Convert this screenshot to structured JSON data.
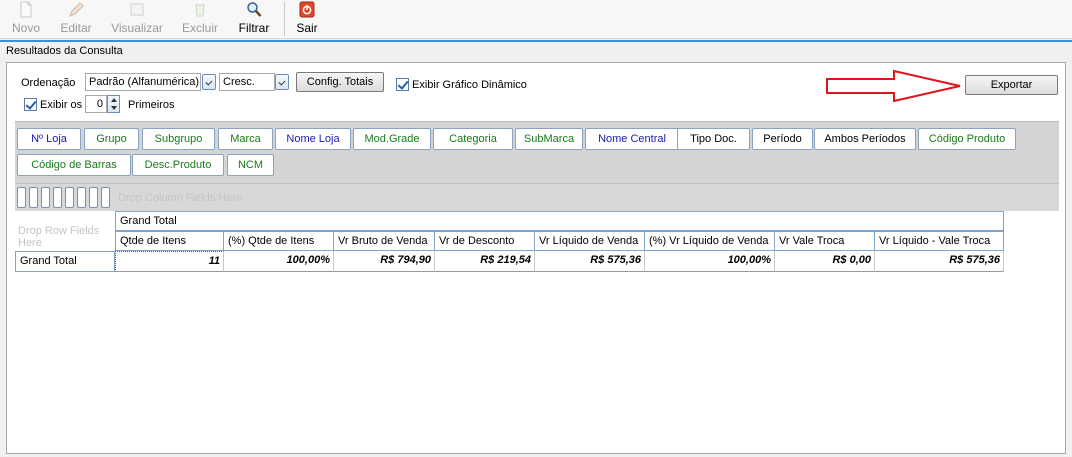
{
  "toolbar": {
    "novo": "Novo",
    "editar": "Editar",
    "visualizar": "Visualizar",
    "excluir": "Excluir",
    "filtrar": "Filtrar",
    "sair": "Sair"
  },
  "window": {
    "title": "Resultados da Consulta"
  },
  "options": {
    "ordenacao_label": "Ordenação",
    "ordenacao_value": "Padrão (Alfanumérica)",
    "order_dir_value": "Cresc.",
    "config_totais": "Config. Totais",
    "exibir_grafico": "Exibir Gráfico Dinâmico",
    "exibir_grafico_checked": true,
    "exibir_os_label": "Exibir os",
    "exibir_os_checked": true,
    "exibir_os_value": "0",
    "primeiros_label": "Primeiros",
    "exportar": "Exportar"
  },
  "field_buttons": {
    "nloja": "Nº Loja",
    "grupo": "Grupo",
    "subgrupo": "Subgrupo",
    "marca": "Marca",
    "nome_loja": "Nome Loja",
    "mod_grade": "Mod.Grade",
    "categoria": "Categoria",
    "submarca": "SubMarca",
    "nome_central": "Nome Central",
    "tipo_doc": "Tipo Doc.",
    "periodo": "Período",
    "ambos_periodos": "Ambos Períodos",
    "codigo_produto": "Código Produto",
    "codigo_barras": "Código de Barras",
    "desc_produto": "Desc.Produto",
    "ncm": "NCM"
  },
  "ghost_text": {
    "column_fields": "Drop Column Fields Here",
    "row_fields": "Drop Row Fields Here"
  },
  "grid": {
    "column_group": "Grand Total",
    "columns": [
      "Qtde de Itens",
      "(%) Qtde de Itens",
      "Vr Bruto de Venda",
      "Vr de Desconto",
      "Vr Líquido de Venda",
      "(%) Vr Líquido de Venda",
      "Vr Vale Troca",
      "Vr Líquido - Vale Troca"
    ],
    "row_label": "Grand Total",
    "values": [
      "11",
      "100,00%",
      "R$ 794,90",
      "R$ 219,54",
      "R$ 575,36",
      "100,00%",
      "R$ 0,00",
      "R$ 575,36"
    ]
  },
  "colors": {
    "field_blue": "#1a1ab0",
    "field_green": "#1a7a1a",
    "arrow_red": "#e0141e",
    "accent_blue": "#3c8fd6"
  }
}
